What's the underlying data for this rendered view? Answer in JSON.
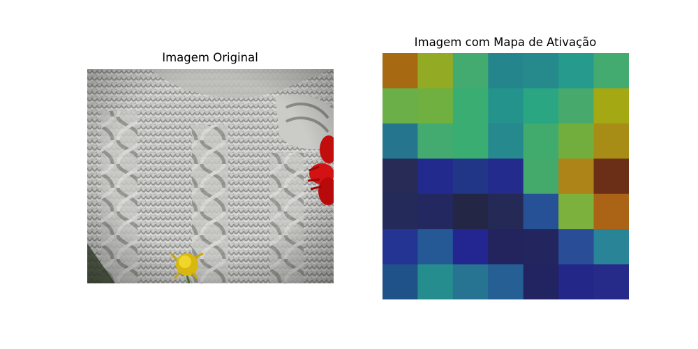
{
  "chart_data": [
    {
      "type": "image",
      "title": "Imagem Original",
      "content": "knitted cable sweater with red flower and yellow dandelion",
      "axis": "off"
    },
    {
      "type": "heatmap",
      "title": "Imagem com Mapa de Ativação",
      "axis": "off",
      "rows": 7,
      "cols": 7,
      "colors": [
        [
          "#a86913",
          "#92aa24",
          "#43ab6f",
          "#25858c",
          "#268a8c",
          "#269a8c",
          "#43ab6f"
        ],
        [
          "#6aaf48",
          "#6fb040",
          "#3aad72",
          "#24938c",
          "#2aa683",
          "#47aa6c",
          "#a4a913"
        ],
        [
          "#25758f",
          "#43ab6f",
          "#3aad72",
          "#25898d",
          "#41ab6e",
          "#72ae3d",
          "#a78d16"
        ],
        [
          "#282b55",
          "#232a8d",
          "#213686",
          "#232b8d",
          "#44aa6b",
          "#ad8417",
          "#6b2f17"
        ],
        [
          "#242b5a",
          "#232860",
          "#232645",
          "#242a55",
          "#275196",
          "#7bb13c",
          "#ab6416"
        ],
        [
          "#243492",
          "#255996",
          "#232690",
          "#23245e",
          "#23255f",
          "#294e97",
          "#2a8498"
        ],
        [
          "#1e5289",
          "#258d8d",
          "#267392",
          "#255f94",
          "#212461",
          "#232788",
          "#262a88"
        ]
      ]
    }
  ]
}
